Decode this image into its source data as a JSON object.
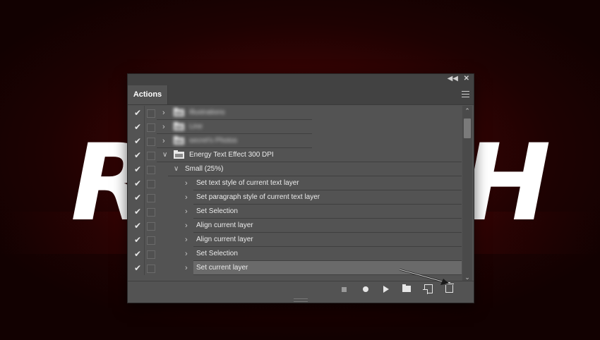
{
  "background": {
    "text_left": "R",
    "text_right": "H",
    "accent": "#5a0a0a"
  },
  "panel": {
    "tab_label": "Actions",
    "menu_icon": "hamburger-menu-icon",
    "rows": [
      {
        "label": "Illustrations",
        "indent": 0,
        "type": "set",
        "expanded": false,
        "blurred": true,
        "checked": true
      },
      {
        "label": "Line",
        "indent": 0,
        "type": "set",
        "expanded": false,
        "blurred": true,
        "checked": true
      },
      {
        "label": "secret's Photos",
        "indent": 0,
        "type": "set",
        "expanded": false,
        "blurred": true,
        "checked": true
      },
      {
        "label": "Energy Text Effect 300 DPI",
        "indent": 0,
        "type": "set",
        "expanded": true,
        "blurred": false,
        "checked": true
      },
      {
        "label": "Small (25%)",
        "indent": 1,
        "type": "action",
        "expanded": true,
        "blurred": false,
        "checked": true
      },
      {
        "label": "Set text style of current text layer",
        "indent": 2,
        "type": "command",
        "expanded": false,
        "blurred": false,
        "checked": true
      },
      {
        "label": "Set paragraph style of current text layer",
        "indent": 2,
        "type": "command",
        "expanded": false,
        "blurred": false,
        "checked": true
      },
      {
        "label": "Set Selection",
        "indent": 2,
        "type": "command",
        "expanded": false,
        "blurred": false,
        "checked": true
      },
      {
        "label": "Align current layer",
        "indent": 2,
        "type": "command",
        "expanded": false,
        "blurred": false,
        "checked": true
      },
      {
        "label": "Align current layer",
        "indent": 2,
        "type": "command",
        "expanded": false,
        "blurred": false,
        "checked": true
      },
      {
        "label": "Set Selection",
        "indent": 2,
        "type": "command",
        "expanded": false,
        "blurred": false,
        "checked": true
      },
      {
        "label": "Set current layer",
        "indent": 2,
        "type": "command",
        "expanded": false,
        "blurred": false,
        "checked": true,
        "selected": true
      }
    ],
    "footer_buttons": [
      "stop-icon",
      "record-icon",
      "play-icon",
      "new-set-folder-icon",
      "new-action-icon",
      "trash-icon"
    ]
  }
}
